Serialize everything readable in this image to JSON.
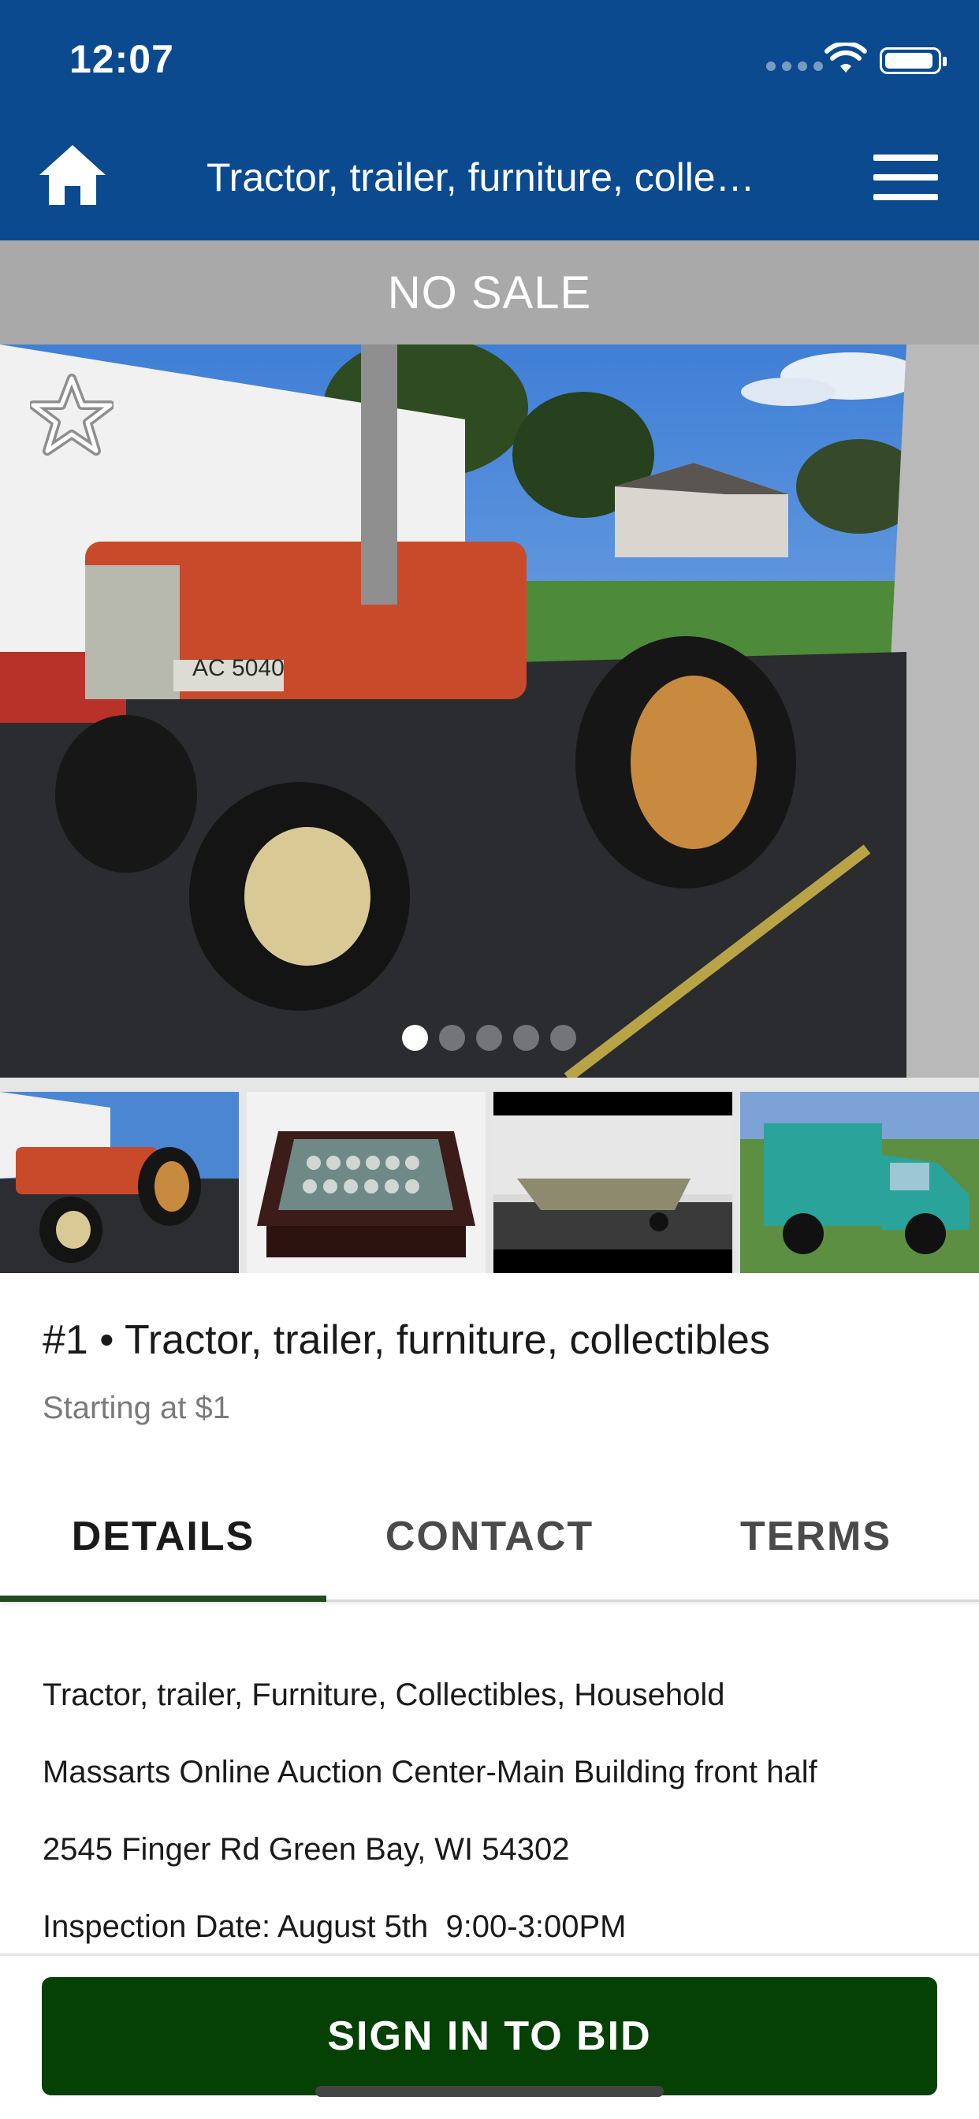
{
  "status_bar": {
    "time": "12:07"
  },
  "nav": {
    "title": "Tractor, trailer, furniture, collectibles",
    "home_icon": "home-icon",
    "menu_icon": "hamburger-menu-icon"
  },
  "banner": {
    "text": "NO SALE"
  },
  "gallery": {
    "favorite_icon": "star-outline-icon",
    "photo_count": 5,
    "active_index": 0,
    "thumbnails": [
      "tractor",
      "coin display case",
      "boat on trailer",
      "teal utility truck"
    ]
  },
  "listing": {
    "title": "#1 • Tractor, trailer, furniture, collectibles",
    "subtitle": "Starting at $1"
  },
  "tabs": [
    {
      "label": "DETAILS",
      "active": true
    },
    {
      "label": "CONTACT",
      "active": false
    },
    {
      "label": "TERMS",
      "active": false
    }
  ],
  "details": {
    "lines": [
      "Tractor, trailer, Furniture, Collectibles, Household",
      "Massarts Online Auction Center-Main Building front half",
      "2545 Finger Rd Green Bay, WI 54302",
      "Inspection Date: August 5th  9:00-3:00PM"
    ]
  },
  "actions": {
    "bid_label": "SIGN IN TO BID"
  },
  "colors": {
    "nav_bg": "#0b4a8f",
    "banner_bg": "#a9a9a9",
    "button_bg": "#054005",
    "tab_indicator": "#1f4d1f"
  }
}
